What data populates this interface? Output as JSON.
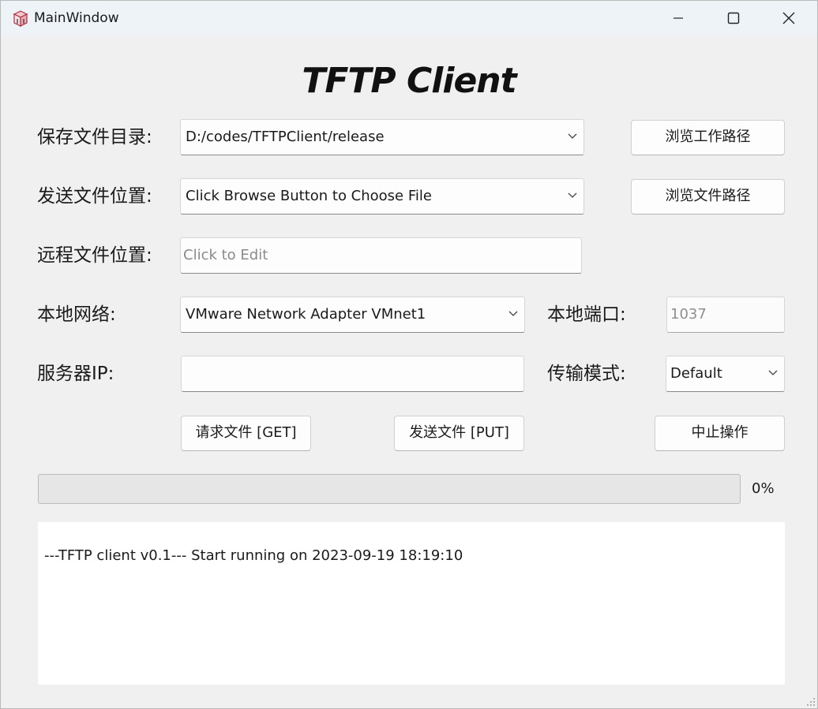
{
  "window": {
    "title": "MainWindow",
    "icon": "app-logo-icon"
  },
  "heading": "TFTP Client",
  "save_dir": {
    "label": "保存文件目录:",
    "value": "D:/codes/TFTPClient/release",
    "browse_label": "浏览工作路径"
  },
  "send_file": {
    "label": "发送文件位置:",
    "value": "Click Browse Button to Choose File",
    "browse_label": "浏览文件路径"
  },
  "remote_file": {
    "label": "远程文件位置:",
    "value": "",
    "placeholder": "Click to Edit"
  },
  "local_network": {
    "label": "本地网络:",
    "value": "VMware Network Adapter VMnet1"
  },
  "local_port": {
    "label": "本地端口:",
    "value": "1037"
  },
  "server_ip": {
    "label": "服务器IP:",
    "value": ""
  },
  "transfer_mode": {
    "label": "传输模式:",
    "value": "Default"
  },
  "actions": {
    "get_label": "请求文件 [GET]",
    "put_label": "发送文件 [PUT]",
    "abort_label": "中止操作"
  },
  "progress": {
    "value": 0,
    "text": "0%"
  },
  "log": {
    "text": "---TFTP client v0.1--- Start running on 2023-09-19 18:19:10"
  }
}
